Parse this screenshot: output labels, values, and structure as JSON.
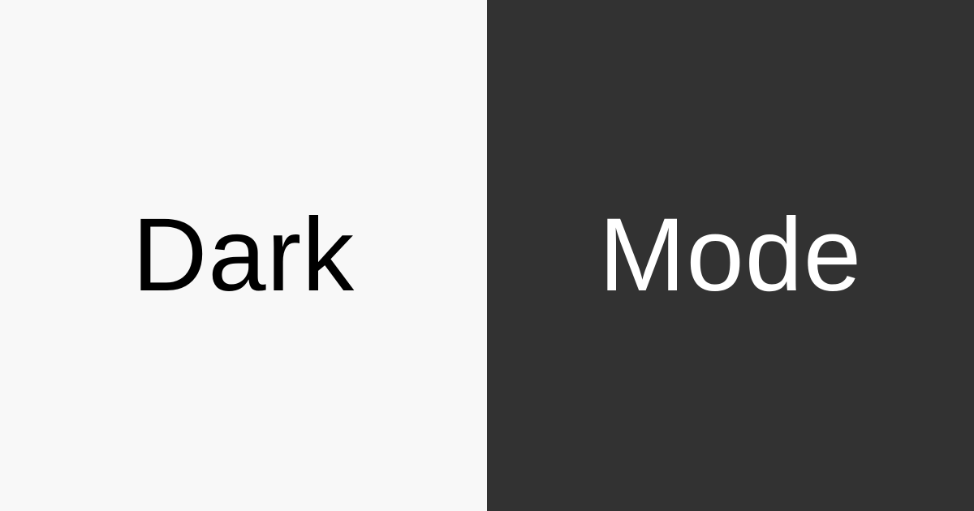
{
  "left": {
    "text": "Dark",
    "background": "#f8f8f8",
    "text_color": "#000000"
  },
  "right": {
    "text": "Mode",
    "background": "#323232",
    "text_color": "#ffffff"
  }
}
